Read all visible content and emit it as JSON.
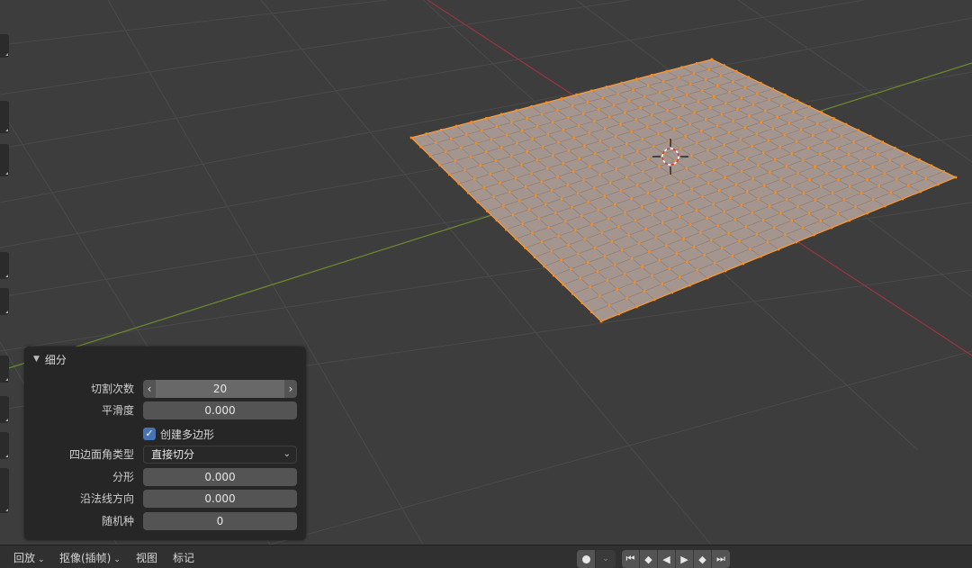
{
  "panel": {
    "title": "细分",
    "fields": {
      "cuts": {
        "label": "切割次数",
        "value": "20"
      },
      "smoothness": {
        "label": "平滑度",
        "value": "0.000"
      },
      "create_ngons": {
        "label": "创建多边形",
        "checked": true
      },
      "quad_corner_type": {
        "label": "四边面角类型",
        "value": "直接切分"
      },
      "fractal": {
        "label": "分形",
        "value": "0.000"
      },
      "along_normal": {
        "label": "沿法线方向",
        "value": "0.000"
      },
      "random_seed": {
        "label": "随机种",
        "value": "0"
      }
    }
  },
  "timeline": {
    "menus": {
      "playback": "回放",
      "keying": "抠像(插帧)",
      "view": "视图",
      "marker": "标记"
    }
  },
  "colors": {
    "mesh_face": "#a4968e",
    "vertex": "#ff8c1a",
    "x_axis": "#9a3540",
    "y_axis": "#6c8c2a",
    "checkbox": "#4772b3"
  },
  "icons": {
    "toolbar": [
      "tool-icon"
    ],
    "playback": [
      "jump-start-icon",
      "prev-keyframe-icon",
      "play-reverse-icon",
      "play-icon",
      "next-keyframe-icon",
      "jump-end-icon"
    ]
  }
}
